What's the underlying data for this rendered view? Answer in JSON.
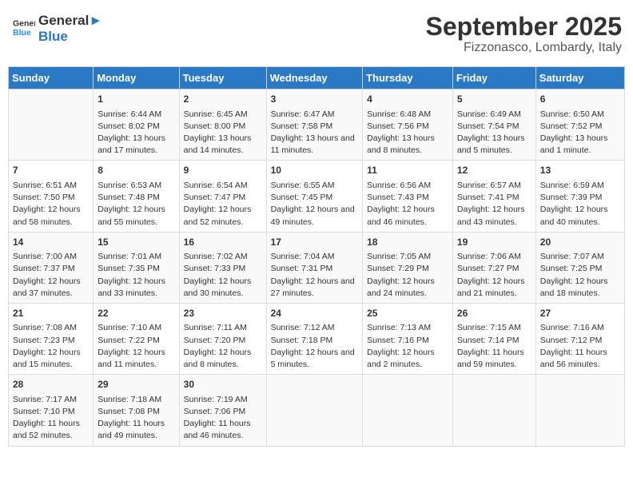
{
  "logo": {
    "line1": "General",
    "line2": "Blue"
  },
  "title": "September 2025",
  "location": "Fizzonasco, Lombardy, Italy",
  "days_of_week": [
    "Sunday",
    "Monday",
    "Tuesday",
    "Wednesday",
    "Thursday",
    "Friday",
    "Saturday"
  ],
  "weeks": [
    [
      {
        "date": "",
        "sunrise": "",
        "sunset": "",
        "daylight": ""
      },
      {
        "date": "1",
        "sunrise": "Sunrise: 6:44 AM",
        "sunset": "Sunset: 8:02 PM",
        "daylight": "Daylight: 13 hours and 17 minutes."
      },
      {
        "date": "2",
        "sunrise": "Sunrise: 6:45 AM",
        "sunset": "Sunset: 8:00 PM",
        "daylight": "Daylight: 13 hours and 14 minutes."
      },
      {
        "date": "3",
        "sunrise": "Sunrise: 6:47 AM",
        "sunset": "Sunset: 7:58 PM",
        "daylight": "Daylight: 13 hours and 11 minutes."
      },
      {
        "date": "4",
        "sunrise": "Sunrise: 6:48 AM",
        "sunset": "Sunset: 7:56 PM",
        "daylight": "Daylight: 13 hours and 8 minutes."
      },
      {
        "date": "5",
        "sunrise": "Sunrise: 6:49 AM",
        "sunset": "Sunset: 7:54 PM",
        "daylight": "Daylight: 13 hours and 5 minutes."
      },
      {
        "date": "6",
        "sunrise": "Sunrise: 6:50 AM",
        "sunset": "Sunset: 7:52 PM",
        "daylight": "Daylight: 13 hours and 1 minute."
      }
    ],
    [
      {
        "date": "7",
        "sunrise": "Sunrise: 6:51 AM",
        "sunset": "Sunset: 7:50 PM",
        "daylight": "Daylight: 12 hours and 58 minutes."
      },
      {
        "date": "8",
        "sunrise": "Sunrise: 6:53 AM",
        "sunset": "Sunset: 7:48 PM",
        "daylight": "Daylight: 12 hours and 55 minutes."
      },
      {
        "date": "9",
        "sunrise": "Sunrise: 6:54 AM",
        "sunset": "Sunset: 7:47 PM",
        "daylight": "Daylight: 12 hours and 52 minutes."
      },
      {
        "date": "10",
        "sunrise": "Sunrise: 6:55 AM",
        "sunset": "Sunset: 7:45 PM",
        "daylight": "Daylight: 12 hours and 49 minutes."
      },
      {
        "date": "11",
        "sunrise": "Sunrise: 6:56 AM",
        "sunset": "Sunset: 7:43 PM",
        "daylight": "Daylight: 12 hours and 46 minutes."
      },
      {
        "date": "12",
        "sunrise": "Sunrise: 6:57 AM",
        "sunset": "Sunset: 7:41 PM",
        "daylight": "Daylight: 12 hours and 43 minutes."
      },
      {
        "date": "13",
        "sunrise": "Sunrise: 6:59 AM",
        "sunset": "Sunset: 7:39 PM",
        "daylight": "Daylight: 12 hours and 40 minutes."
      }
    ],
    [
      {
        "date": "14",
        "sunrise": "Sunrise: 7:00 AM",
        "sunset": "Sunset: 7:37 PM",
        "daylight": "Daylight: 12 hours and 37 minutes."
      },
      {
        "date": "15",
        "sunrise": "Sunrise: 7:01 AM",
        "sunset": "Sunset: 7:35 PM",
        "daylight": "Daylight: 12 hours and 33 minutes."
      },
      {
        "date": "16",
        "sunrise": "Sunrise: 7:02 AM",
        "sunset": "Sunset: 7:33 PM",
        "daylight": "Daylight: 12 hours and 30 minutes."
      },
      {
        "date": "17",
        "sunrise": "Sunrise: 7:04 AM",
        "sunset": "Sunset: 7:31 PM",
        "daylight": "Daylight: 12 hours and 27 minutes."
      },
      {
        "date": "18",
        "sunrise": "Sunrise: 7:05 AM",
        "sunset": "Sunset: 7:29 PM",
        "daylight": "Daylight: 12 hours and 24 minutes."
      },
      {
        "date": "19",
        "sunrise": "Sunrise: 7:06 AM",
        "sunset": "Sunset: 7:27 PM",
        "daylight": "Daylight: 12 hours and 21 minutes."
      },
      {
        "date": "20",
        "sunrise": "Sunrise: 7:07 AM",
        "sunset": "Sunset: 7:25 PM",
        "daylight": "Daylight: 12 hours and 18 minutes."
      }
    ],
    [
      {
        "date": "21",
        "sunrise": "Sunrise: 7:08 AM",
        "sunset": "Sunset: 7:23 PM",
        "daylight": "Daylight: 12 hours and 15 minutes."
      },
      {
        "date": "22",
        "sunrise": "Sunrise: 7:10 AM",
        "sunset": "Sunset: 7:22 PM",
        "daylight": "Daylight: 12 hours and 11 minutes."
      },
      {
        "date": "23",
        "sunrise": "Sunrise: 7:11 AM",
        "sunset": "Sunset: 7:20 PM",
        "daylight": "Daylight: 12 hours and 8 minutes."
      },
      {
        "date": "24",
        "sunrise": "Sunrise: 7:12 AM",
        "sunset": "Sunset: 7:18 PM",
        "daylight": "Daylight: 12 hours and 5 minutes."
      },
      {
        "date": "25",
        "sunrise": "Sunrise: 7:13 AM",
        "sunset": "Sunset: 7:16 PM",
        "daylight": "Daylight: 12 hours and 2 minutes."
      },
      {
        "date": "26",
        "sunrise": "Sunrise: 7:15 AM",
        "sunset": "Sunset: 7:14 PM",
        "daylight": "Daylight: 11 hours and 59 minutes."
      },
      {
        "date": "27",
        "sunrise": "Sunrise: 7:16 AM",
        "sunset": "Sunset: 7:12 PM",
        "daylight": "Daylight: 11 hours and 56 minutes."
      }
    ],
    [
      {
        "date": "28",
        "sunrise": "Sunrise: 7:17 AM",
        "sunset": "Sunset: 7:10 PM",
        "daylight": "Daylight: 11 hours and 52 minutes."
      },
      {
        "date": "29",
        "sunrise": "Sunrise: 7:18 AM",
        "sunset": "Sunset: 7:08 PM",
        "daylight": "Daylight: 11 hours and 49 minutes."
      },
      {
        "date": "30",
        "sunrise": "Sunrise: 7:19 AM",
        "sunset": "Sunset: 7:06 PM",
        "daylight": "Daylight: 11 hours and 46 minutes."
      },
      {
        "date": "",
        "sunrise": "",
        "sunset": "",
        "daylight": ""
      },
      {
        "date": "",
        "sunrise": "",
        "sunset": "",
        "daylight": ""
      },
      {
        "date": "",
        "sunrise": "",
        "sunset": "",
        "daylight": ""
      },
      {
        "date": "",
        "sunrise": "",
        "sunset": "",
        "daylight": ""
      }
    ]
  ]
}
